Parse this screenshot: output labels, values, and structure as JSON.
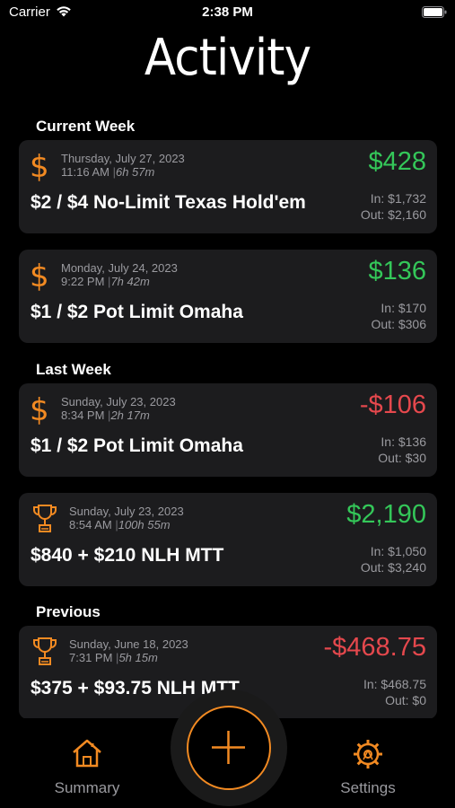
{
  "status": {
    "carrier": "Carrier",
    "time": "2:38 PM"
  },
  "title": "Activity",
  "sections": [
    {
      "header": "Current Week"
    },
    {
      "header": "Last Week"
    },
    {
      "header": "Previous"
    }
  ],
  "cards": [
    {
      "icon": "dollar-icon",
      "date": "Thursday, July 27, 2023",
      "time": "11:16 AM",
      "duration": "6h 57m",
      "title": "$2 / $4 No-Limit Texas Hold'em",
      "result": "$428",
      "in": "In: $1,732",
      "out": "Out: $2,160",
      "positive": true
    },
    {
      "icon": "dollar-icon",
      "date": "Monday, July 24, 2023",
      "time": "9:22 PM",
      "duration": "7h 42m",
      "title": "$1 / $2 Pot Limit Omaha",
      "result": "$136",
      "in": "In: $170",
      "out": "Out: $306",
      "positive": true
    },
    {
      "icon": "dollar-icon",
      "date": "Sunday, July 23, 2023",
      "time": "8:34 PM",
      "duration": "2h 17m",
      "title": "$1 / $2 Pot Limit Omaha",
      "result": "-$106",
      "in": "In: $136",
      "out": "Out: $30",
      "positive": false
    },
    {
      "icon": "trophy-icon",
      "date": "Sunday, July 23, 2023",
      "time": "8:54 AM",
      "duration": "100h 55m",
      "title": "$840 + $210 NLH MTT",
      "result": "$2,190",
      "in": "In: $1,050",
      "out": "Out: $3,240",
      "positive": true
    },
    {
      "icon": "trophy-icon",
      "date": "Sunday, June 18, 2023",
      "time": "7:31 PM",
      "duration": "5h 15m",
      "title": "$375 + $93.75 NLH MTT",
      "result": "-$468.75",
      "in": "In: $468.75",
      "out": "Out: $0",
      "positive": false
    }
  ],
  "tabs": {
    "summary": "Summary",
    "settings": "Settings"
  },
  "colors": {
    "accent": "#f28a22",
    "positive": "#34c759",
    "negative": "#e5484d",
    "card": "#1c1c1e"
  },
  "icons": {
    "summary": "house-icon",
    "add": "plus-icon",
    "settings": "gear-icon"
  }
}
